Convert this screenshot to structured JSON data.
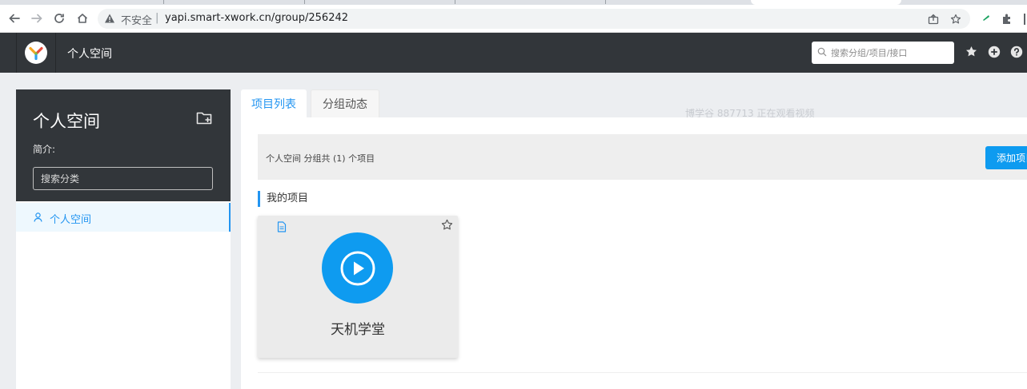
{
  "browser": {
    "insecure_label": "不安全",
    "separator": "|",
    "url": "yapi.smart-xwork.cn/group/256242"
  },
  "header": {
    "title": "个人空间",
    "search_placeholder": "搜索分组/项目/接口"
  },
  "sidebar": {
    "group_name": "个人空间",
    "intro_label": "简介:",
    "category_search_placeholder": "搜索分类",
    "items": [
      {
        "label": "个人空间",
        "selected": true
      }
    ]
  },
  "tabs": [
    {
      "label": "项目列表",
      "active": true
    },
    {
      "label": "分组动态",
      "active": false
    }
  ],
  "watermark": "博学谷 887713 正在观看视频",
  "content": {
    "info_text": "个人空间 分组共 (1) 个项目",
    "add_button": "添加项目",
    "section_title": "我的项目",
    "projects": [
      {
        "name": "天机学堂"
      }
    ]
  },
  "colors": {
    "accent": "#2395f1",
    "header_bg": "#32363a",
    "button_bg": "#0e9bf0"
  }
}
